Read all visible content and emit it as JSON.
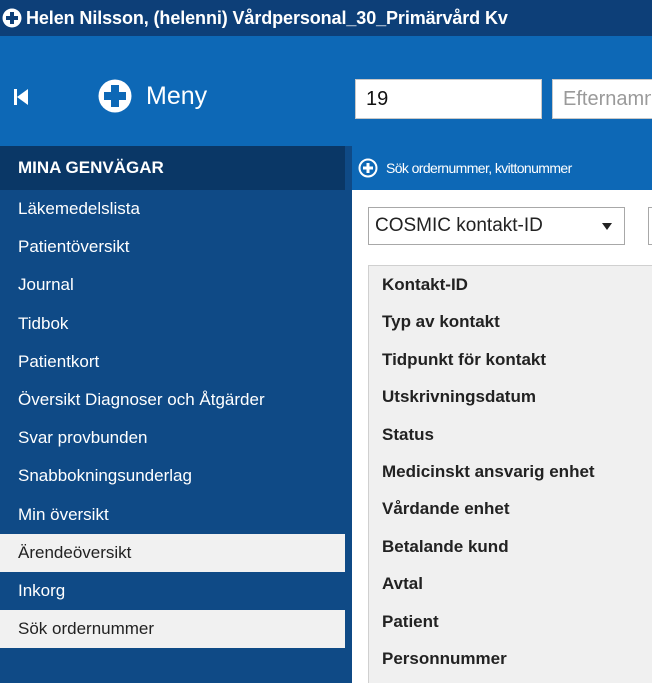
{
  "titlebar": {
    "title": "Helen  Nilsson, (helenni) Vårdpersonal_30_Primärvård Kv"
  },
  "header": {
    "menu_label": "Meny",
    "patient_input_value": "19",
    "name_input_placeholder": "Efternamn"
  },
  "sidebar": {
    "header": "MINA GENVÄGAR",
    "items": [
      {
        "label": "Läkemedelslista"
      },
      {
        "label": "Patientöversikt"
      },
      {
        "label": "Journal"
      },
      {
        "label": "Tidbok"
      },
      {
        "label": "Patientkort"
      },
      {
        "label": "Översikt Diagnoser och Åtgärder"
      },
      {
        "label": "Svar provbunden"
      },
      {
        "label": "Snabbokningsunderlag"
      },
      {
        "label": "Min översikt"
      },
      {
        "label": "Ärendeöversikt"
      },
      {
        "label": "Inkorg"
      },
      {
        "label": "Sök ordernummer"
      }
    ]
  },
  "main": {
    "header": "Sök ordernummer, kvittonummer",
    "select_value": "COSMIC kontakt-ID",
    "fields": [
      "Kontakt-ID",
      "Typ av kontakt",
      "Tidpunkt för kontakt",
      "Utskrivningsdatum",
      "Status",
      "Medicinskt ansvarig enhet",
      "Vårdande enhet",
      "Betalande kund",
      "Avtal",
      "Patient",
      "Personnummer"
    ]
  },
  "icons": {
    "app_logo": "plus-circle-icon",
    "collapse": "skip-back-icon",
    "select_caret": "caret-down-icon"
  },
  "colors": {
    "titlebar": "#0d3f78",
    "header": "#0d68b6",
    "sidebar": "#0f4a86",
    "sidebar_header": "#0a3766",
    "highlight": "#f1f1f1"
  }
}
